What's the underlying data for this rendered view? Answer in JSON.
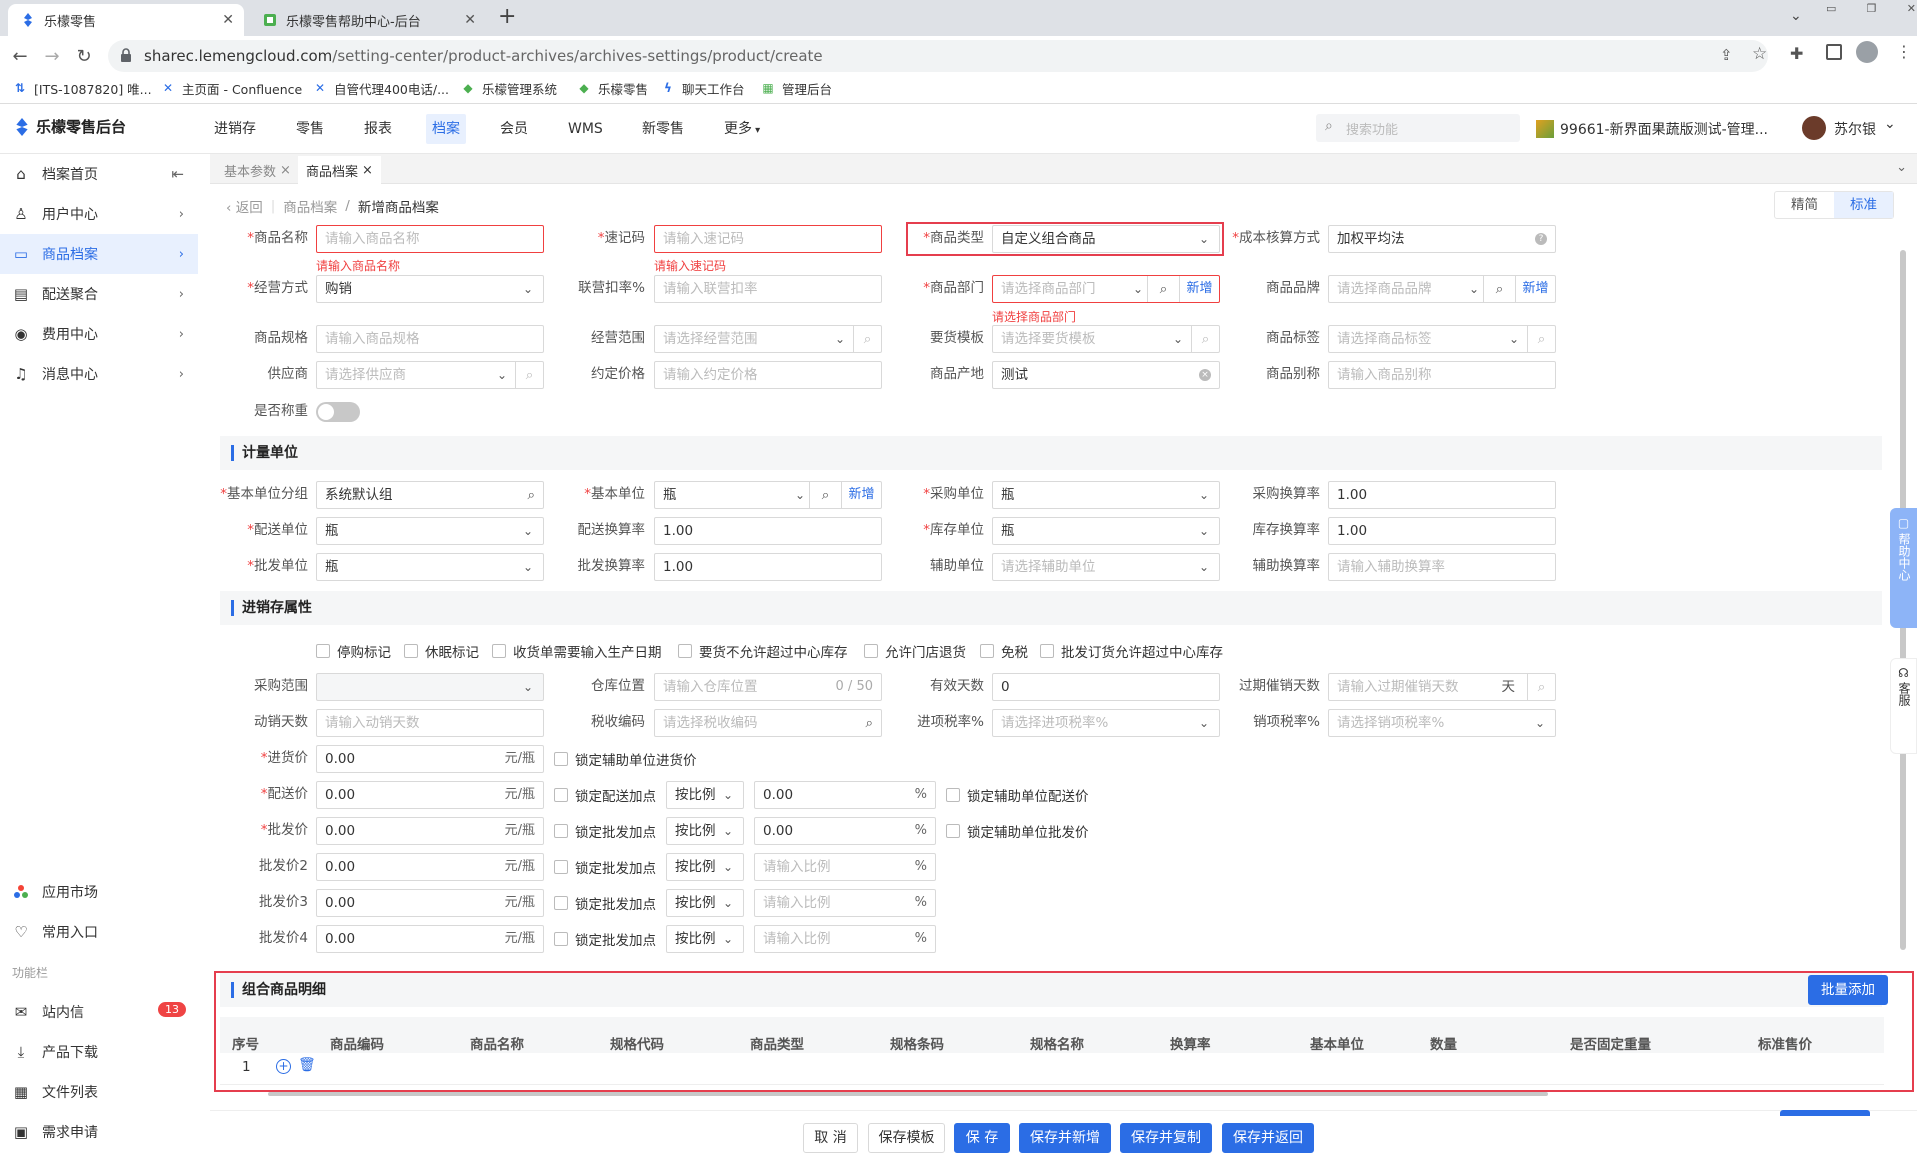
{
  "browser": {
    "tabs": [
      {
        "title": "乐檬零售",
        "active": true
      },
      {
        "title": "乐檬零售帮助中心-后台",
        "active": false
      }
    ],
    "new_tab": "+",
    "url_host": "sharec.lemengcloud.com",
    "url_path": "/setting-center/product-archives/archives-settings/product/create",
    "bookmarks": [
      "[ITS-1087820] 唯...",
      "主页面 - Confluence",
      "自管代理400电话/...",
      "乐檬管理系统",
      "乐檬零售",
      "聊天工作台",
      "管理后台"
    ]
  },
  "app": {
    "logo": "乐檬零售后台",
    "nav": [
      "进销存",
      "零售",
      "报表",
      "档案",
      "会员",
      "WMS",
      "新零售",
      "更多"
    ],
    "active_nav": "档案",
    "search_placeholder": "搜索功能",
    "store": "99661-新界面果蔬版测试-管理...",
    "user": "苏尔银"
  },
  "sidebar": {
    "items": [
      {
        "label": "档案首页",
        "icon": "home-icon"
      },
      {
        "label": "用户中心",
        "icon": "user-icon"
      },
      {
        "label": "商品档案",
        "icon": "product-icon",
        "active": true
      },
      {
        "label": "配送聚合",
        "icon": "delivery-icon"
      },
      {
        "label": "费用中心",
        "icon": "fee-icon"
      },
      {
        "label": "消息中心",
        "icon": "bell-icon"
      }
    ],
    "bottom": [
      {
        "label": "应用市场",
        "icon": "app-market-icon"
      },
      {
        "label": "常用入口",
        "icon": "heart-icon"
      }
    ],
    "section_title": "功能栏",
    "tools": [
      {
        "label": "站内信",
        "icon": "mail-icon",
        "badge": "13"
      },
      {
        "label": "产品下载",
        "icon": "download-icon"
      },
      {
        "label": "文件列表",
        "icon": "file-list-icon"
      },
      {
        "label": "需求申请",
        "icon": "request-icon"
      }
    ]
  },
  "content_tabs": [
    {
      "label": "基本参数",
      "active": false
    },
    {
      "label": "商品档案",
      "active": true
    }
  ],
  "breadcrumb": {
    "back": "返回",
    "parent": "商品档案",
    "sep": "/",
    "current": "新增商品档案"
  },
  "view_toggle": {
    "simple": "精简",
    "standard": "标准"
  },
  "basic": {
    "name_label": "商品名称",
    "name_ph": "请输入商品名称",
    "name_err": "请输入商品名称",
    "code_label": "速记码",
    "code_ph": "请输入速记码",
    "code_err": "请输入速记码",
    "type_label": "商品类型",
    "type_val": "自定义组合商品",
    "cost_label": "成本核算方式",
    "cost_val": "加权平均法",
    "mode_label": "经营方式",
    "mode_val": "购销",
    "deduct_label": "联营扣率%",
    "deduct_ph": "请输入联营扣率",
    "dept_label": "商品部门",
    "dept_ph": "请选择商品部门",
    "dept_err": "请选择商品部门",
    "dept_add": "新增",
    "brand_label": "商品品牌",
    "brand_ph": "请选择商品品牌",
    "brand_add": "新增",
    "spec_label": "商品规格",
    "spec_ph": "请输入商品规格",
    "scope_label": "经营范围",
    "scope_ph": "请选择经营范围",
    "tmpl_label": "要货模板",
    "tmpl_ph": "请选择要货模板",
    "tag_label": "商品标签",
    "tag_ph": "请选择商品标签",
    "supplier_label": "供应商",
    "supplier_ph": "请选择供应商",
    "price_label": "约定价格",
    "price_ph": "请输入约定价格",
    "origin_label": "商品产地",
    "origin_val": "测试",
    "alias_label": "商品别称",
    "alias_ph": "请输入商品别称",
    "weigh_label": "是否称重"
  },
  "unit_section": {
    "title": "计量单位",
    "group_label": "基本单位分组",
    "group_val": "系统默认组",
    "base_label": "基本单位",
    "base_val": "瓶",
    "base_add": "新增",
    "purchase_label": "采购单位",
    "purchase_val": "瓶",
    "purchase_rate_label": "采购换算率",
    "purchase_rate_val": "1.00",
    "delivery_label": "配送单位",
    "delivery_val": "瓶",
    "delivery_rate_label": "配送换算率",
    "delivery_rate_val": "1.00",
    "stock_label": "库存单位",
    "stock_val": "瓶",
    "stock_rate_label": "库存换算率",
    "stock_rate_val": "1.00",
    "wholesale_label": "批发单位",
    "wholesale_val": "瓶",
    "wholesale_rate_label": "批发换算率",
    "wholesale_rate_val": "1.00",
    "aux_label": "辅助单位",
    "aux_ph": "请选择辅助单位",
    "aux_rate_label": "辅助换算率",
    "aux_rate_ph": "请输入辅助换算率"
  },
  "inv_section": {
    "title": "进销存属性",
    "checks": [
      "停购标记",
      "休眠标记",
      "收货单需要输入生产日期",
      "要货不允许超过中心库存",
      "允许门店退货",
      "免税",
      "批发订货允许超过中心库存"
    ],
    "prange_label": "采购范围",
    "loc_label": "仓库位置",
    "loc_ph": "请输入仓库位置",
    "loc_count": "0 / 50",
    "valid_label": "有效天数",
    "valid_val": "0",
    "overdue_label": "过期催销天数",
    "overdue_ph": "请输入过期催销天数",
    "overdue_unit": "天",
    "move_label": "动销天数",
    "move_ph": "请输入动销天数",
    "tax_code_label": "税收编码",
    "tax_code_ph": "请选择税收编码",
    "in_tax_label": "进项税率%",
    "in_tax_ph": "请选择进项税率%",
    "out_tax_label": "销项税率%",
    "out_tax_ph": "请选择销项税率%",
    "price_unit": "元/瓶",
    "pct": "%",
    "ratio_mode": "按比例",
    "ratio_ph": "请输入比例",
    "prices": [
      {
        "label": "进货价",
        "req": true,
        "val": "0.00",
        "lock": "锁定辅助单位进货价"
      },
      {
        "label": "配送价",
        "req": true,
        "val": "0.00",
        "lock": "锁定配送加点",
        "ratio": "0.00",
        "lock2": "锁定辅助单位配送价"
      },
      {
        "label": "批发价",
        "req": true,
        "val": "0.00",
        "lock": "锁定批发加点",
        "ratio": "0.00",
        "lock2": "锁定辅助单位批发价"
      },
      {
        "label": "批发价2",
        "req": false,
        "val": "0.00",
        "lock": "锁定批发加点"
      },
      {
        "label": "批发价3",
        "req": false,
        "val": "0.00",
        "lock": "锁定批发加点"
      },
      {
        "label": "批发价4",
        "req": false,
        "val": "0.00",
        "lock": "锁定批发加点"
      }
    ]
  },
  "combo_section": {
    "title": "组合商品明细",
    "batch_add": "批量添加",
    "columns": [
      "序号",
      "商品编码",
      "商品名称",
      "规格代码",
      "商品类型",
      "规格条码",
      "规格名称",
      "换算率",
      "基本单位",
      "数量",
      "是否固定重量",
      "标准售价"
    ],
    "rows": [
      {
        "idx": "1"
      }
    ]
  },
  "side_float": {
    "help": "帮助中心",
    "service": "客服"
  },
  "footer": {
    "cancel": "取 消",
    "save_tmpl": "保存模板",
    "save": "保 存",
    "save_new": "保存并新增",
    "save_copy": "保存并复制",
    "save_back": "保存并返回"
  }
}
